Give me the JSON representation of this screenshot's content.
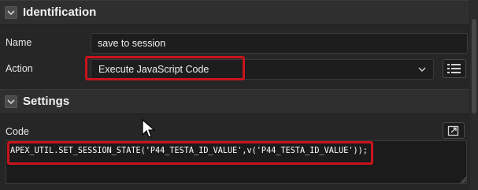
{
  "identification": {
    "title": "Identification",
    "name_label": "Name",
    "name_value": "save to session",
    "action_label": "Action",
    "action_value": "Execute JavaScript Code"
  },
  "settings": {
    "title": "Settings",
    "code_label": "Code",
    "code_value": "APEX_UTIL.SET_SESSION_STATE('P44_TESTA_ID_VALUE',v('P44_TESTA_ID_VALUE'));"
  },
  "icons": {
    "section_toggle": "chevron-down-icon",
    "dropdown": "chevron-down-icon",
    "list_view": "list-icon",
    "expand_editor": "expand-icon",
    "cursor": "mouse-pointer-icon"
  },
  "colors": {
    "background": "#262626",
    "highlight_border": "#c8141c"
  }
}
